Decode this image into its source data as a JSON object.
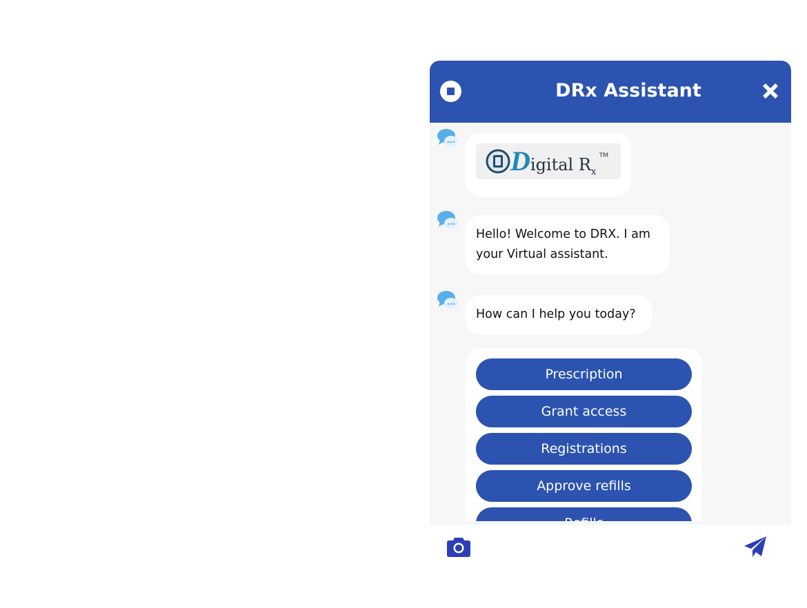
{
  "header": {
    "title": "DRx Assistant",
    "stop_icon": "stop-icon",
    "close_icon": "close-icon"
  },
  "messages": [
    {
      "type": "image",
      "logo": {
        "main": "igital R",
        "mark": "D",
        "sub": "x",
        "tm": "TM"
      }
    },
    {
      "type": "text",
      "text": "Hello! Welcome to DRX. I am your Virtual assistant."
    },
    {
      "type": "text",
      "text": "How can I help you today?"
    }
  ],
  "options": [
    "Prescription",
    "Grant access",
    "Registrations",
    "Approve refills",
    "Refills"
  ],
  "footer": {
    "camera_icon": "camera-icon",
    "send_icon": "send-icon"
  },
  "colors": {
    "brand": "#2c53b0",
    "chat_background": "#f7f7f7",
    "bubble": "#ffffff"
  }
}
